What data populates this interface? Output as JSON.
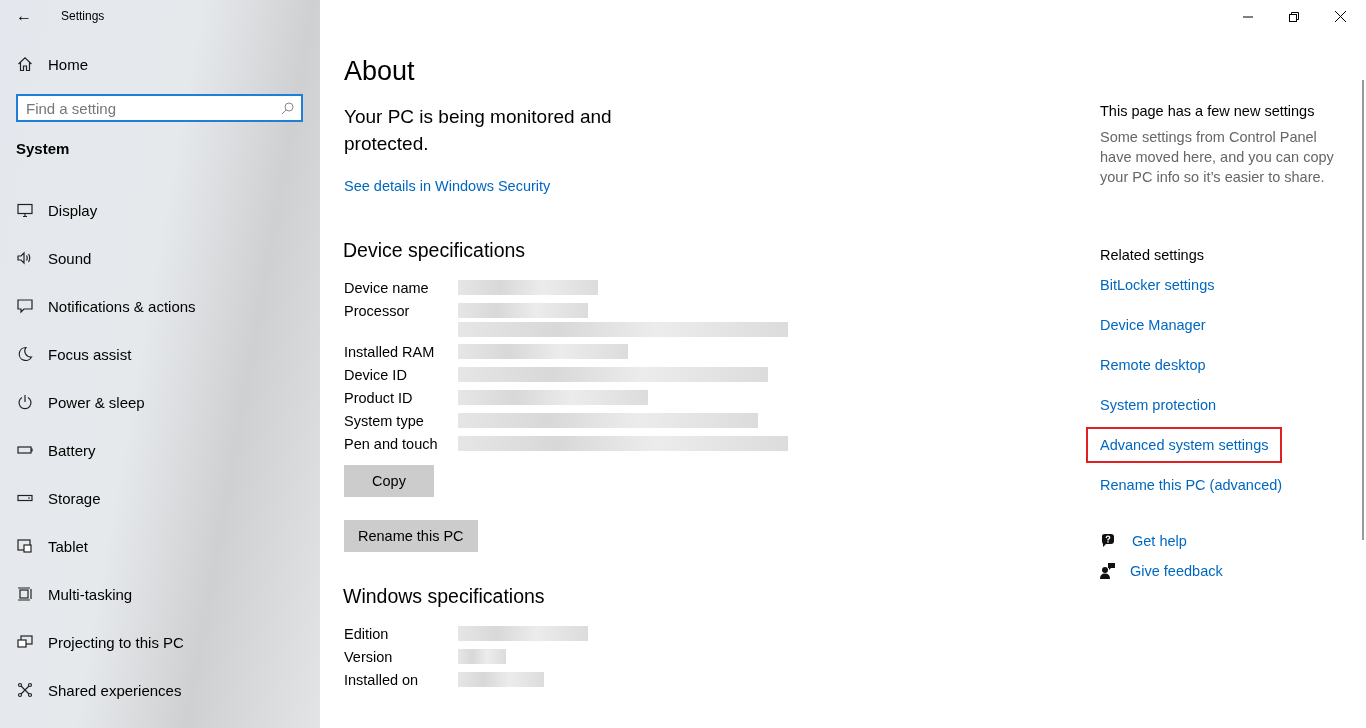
{
  "window": {
    "title": "Settings",
    "back": "←"
  },
  "sidebar": {
    "home": "Home",
    "search": {
      "placeholder": "Find a setting"
    },
    "section": "System",
    "items": [
      {
        "label": "Display",
        "selected": false
      },
      {
        "label": "Sound",
        "selected": false
      },
      {
        "label": "Notifications & actions",
        "selected": false
      },
      {
        "label": "Focus assist",
        "selected": false
      },
      {
        "label": "Power & sleep",
        "selected": false
      },
      {
        "label": "Battery",
        "selected": false
      },
      {
        "label": "Storage",
        "selected": false
      },
      {
        "label": "Tablet",
        "selected": false
      },
      {
        "label": "Multi-tasking",
        "selected": false
      },
      {
        "label": "Projecting to this PC",
        "selected": false
      },
      {
        "label": "Shared experiences",
        "selected": false
      }
    ]
  },
  "page": {
    "title": "About",
    "status": "Your PC is being monitored and protected.",
    "status_link": "See details in Windows Security",
    "device_specs": {
      "heading": "Device specifications",
      "rows": [
        {
          "label": "Device name"
        },
        {
          "label": "Processor"
        },
        {
          "label": "Installed RAM"
        },
        {
          "label": "Device ID"
        },
        {
          "label": "Product ID"
        },
        {
          "label": "System type"
        },
        {
          "label": "Pen and touch"
        }
      ],
      "buttons": [
        "Copy",
        "Rename this PC"
      ]
    },
    "windows_specs": {
      "heading": "Windows specifications",
      "rows": [
        {
          "label": "Edition"
        },
        {
          "label": "Version"
        },
        {
          "label": "Installed on"
        }
      ]
    }
  },
  "aside": {
    "notice_title": "This page has a few new settings",
    "notice_text": "Some settings from Control Panel have moved here, and you can copy your PC info so it’s easier to share.",
    "related_title": "Related settings",
    "related": [
      {
        "label": "BitLocker settings",
        "highlighted": false
      },
      {
        "label": "Device Manager",
        "highlighted": false
      },
      {
        "label": "Remote desktop",
        "highlighted": false
      },
      {
        "label": "System protection",
        "highlighted": false
      },
      {
        "label": "Advanced system settings",
        "highlighted": true
      },
      {
        "label": "Rename this PC (advanced)",
        "highlighted": false
      }
    ],
    "help": [
      {
        "kind": "help",
        "label": "Get help"
      },
      {
        "kind": "feedback",
        "label": "Give feedback"
      }
    ]
  }
}
